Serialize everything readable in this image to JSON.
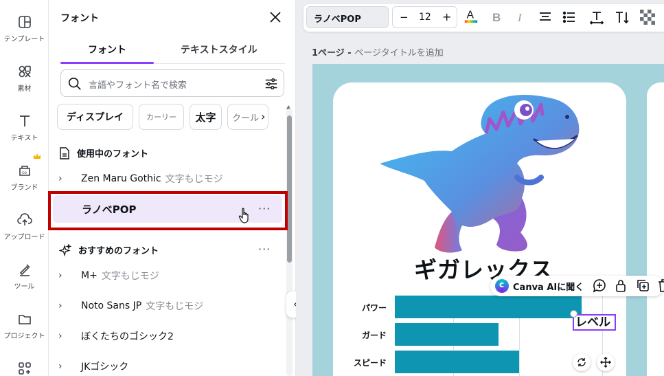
{
  "rail": {
    "items": [
      {
        "label": "テンプレート",
        "icon": "template-icon"
      },
      {
        "label": "素材",
        "icon": "elements-icon"
      },
      {
        "label": "テキスト",
        "icon": "text-icon"
      },
      {
        "label": "ブランド",
        "icon": "brand-icon"
      },
      {
        "label": "アップロード",
        "icon": "upload-icon"
      },
      {
        "label": "ツール",
        "icon": "tools-icon"
      },
      {
        "label": "プロジェクト",
        "icon": "folder-icon"
      }
    ]
  },
  "panel": {
    "title": "フォント",
    "tabs": [
      {
        "label": "フォント",
        "active": true
      },
      {
        "label": "テキストスタイル",
        "active": false
      }
    ],
    "search_placeholder": "言語やフォント名で検索",
    "chips": [
      "ディスプレイ",
      "カーリー",
      "太字",
      "クール"
    ],
    "in_use_heading": "使用中のフォント",
    "in_use": [
      {
        "name": "Zen Maru Gothic",
        "sample": "文字もじモジ"
      },
      {
        "name": "ラノベPOP",
        "selected": true
      }
    ],
    "more_label": "···",
    "recommended_heading": "おすすめのフォント",
    "recommended": [
      {
        "name": "M+",
        "sample": "文字もじモジ"
      },
      {
        "name": "Noto Sans JP",
        "sample": "文字もじモジ"
      },
      {
        "name": "ぼくたちのゴシック2",
        "sample": ""
      },
      {
        "name": "JKゴシック",
        "sample": ""
      }
    ],
    "accent_color": "#8b3dff",
    "highlight_color": "#c00000"
  },
  "toolbar": {
    "font_name": "ラノベPOP",
    "font_size": "12",
    "minus": "−",
    "plus": "+"
  },
  "page": {
    "number_label": "1ページ - ",
    "title_placeholder": "ページタイトルを追加"
  },
  "design": {
    "title": "ギガレックス",
    "selected_text": "レベル",
    "bar_color": "#0d95b1",
    "background_color": "#a5d3db"
  },
  "chart_data": {
    "type": "bar",
    "orientation": "horizontal",
    "categories": [
      "パワー",
      "ガード",
      "スピード"
    ],
    "values": [
      90,
      50,
      60
    ],
    "xlim": [
      0,
      100
    ],
    "title": "",
    "xlabel": "",
    "ylabel": ""
  },
  "ai_bar": {
    "label": "Canva AIに聞く"
  }
}
